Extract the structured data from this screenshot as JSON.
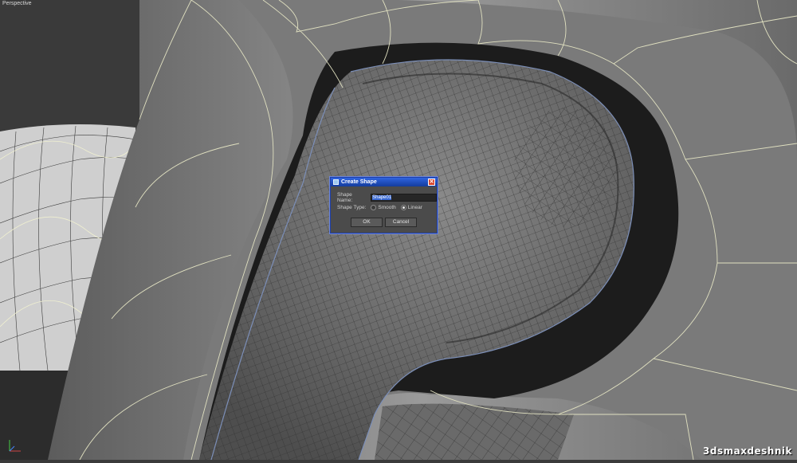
{
  "viewport": {
    "label": "Perspective"
  },
  "dialog": {
    "title": "Create Shape",
    "shape_name_label": "Shape Name:",
    "shape_name_value": "Shape01",
    "shape_type_label": "Shape Type:",
    "shape_type_options": [
      "Smooth",
      "Linear"
    ],
    "selected_type": "Linear",
    "ok_label": "OK",
    "cancel_label": "Cancel"
  },
  "watermark": "3dsmaxdeshnik",
  "colors": {
    "title_bar": "#2f64e0",
    "dialog_bg": "#4b4b4b",
    "wire": "#e0e0c0",
    "mesh": "#5a5a5a"
  }
}
